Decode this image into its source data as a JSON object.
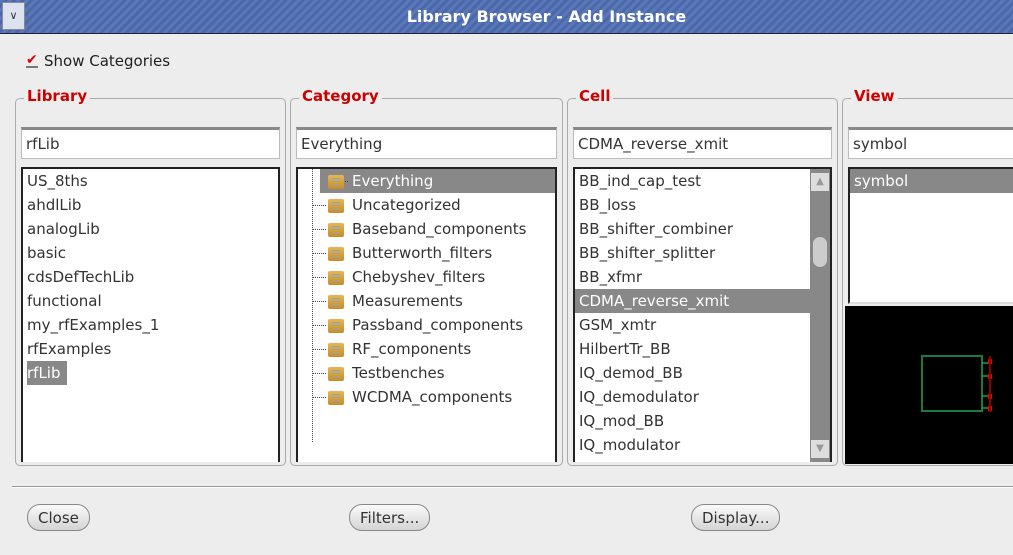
{
  "window": {
    "title": "Library Browser - Add Instance",
    "menu_icon": "chevron-down"
  },
  "show_categories": {
    "label": "Show Categories",
    "checked": true
  },
  "library": {
    "label": "Library",
    "value": "rfLib",
    "items": [
      "US_8ths",
      "ahdlLib",
      "analogLib",
      "basic",
      "cdsDefTechLib",
      "functional",
      "my_rfExamples_1",
      "rfExamples",
      "rfLib"
    ],
    "selected": "rfLib"
  },
  "category": {
    "label": "Category",
    "value": "Everything",
    "items": [
      "Everything",
      "Uncategorized",
      "Baseband_components",
      "Butterworth_filters",
      "Chebyshev_filters",
      "Measurements",
      "Passband_components",
      "RF_components",
      "Testbenches",
      "WCDMA_components"
    ],
    "selected": "Everything"
  },
  "cell": {
    "label": "Cell",
    "value": "CDMA_reverse_xmit",
    "items": [
      "BB_ind_cap_test",
      "BB_loss",
      "BB_shifter_combiner",
      "BB_shifter_splitter",
      "BB_xfmr",
      "CDMA_reverse_xmit",
      "GSM_xmtr",
      "HilbertTr_BB",
      "IQ_demod_BB",
      "IQ_demodulator",
      "IQ_mod_BB",
      "IQ_modulator"
    ],
    "selected": "CDMA_reverse_xmit"
  },
  "view": {
    "label": "View",
    "value": "symbol",
    "items": [
      "symbol"
    ],
    "selected": "symbol"
  },
  "buttons": {
    "close": "Close",
    "filters": "Filters...",
    "display": "Display..."
  }
}
